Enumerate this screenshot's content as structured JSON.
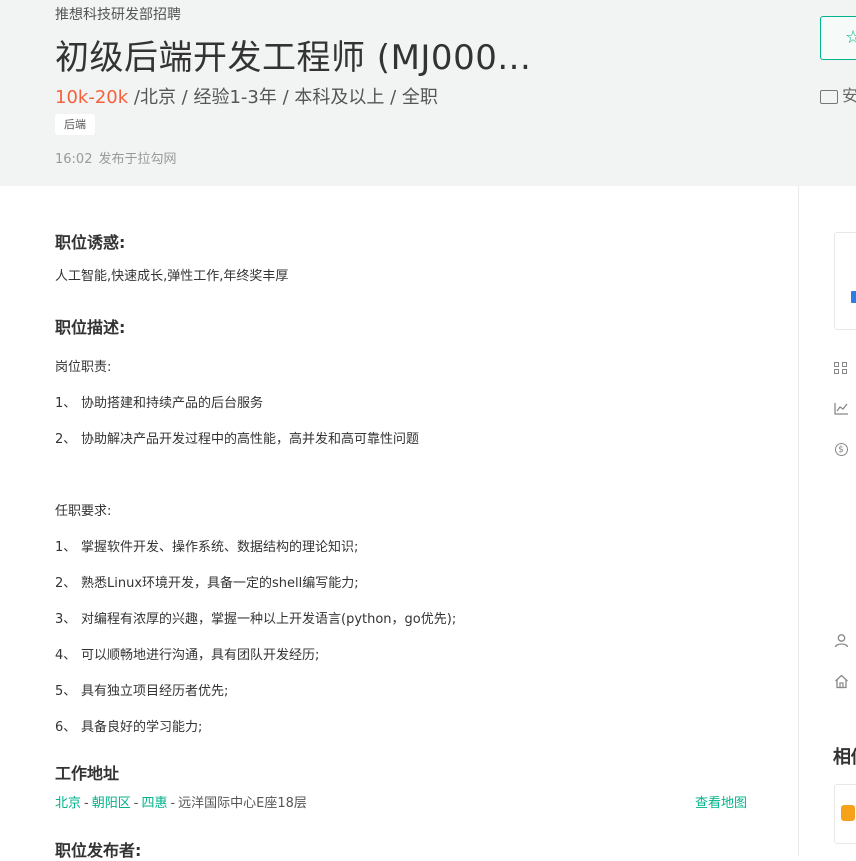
{
  "header": {
    "department": "推想科技研发部招聘",
    "title": "初级后端开发工程师 (MJ000...",
    "salary": "10k-20k",
    "details": " /北京 / 经验1-3年 / 本科及以上 / 全职",
    "tag": "后端",
    "publish_time": "16:02",
    "publish_source": "发布于拉勾网",
    "report_label": "安"
  },
  "content": {
    "perks_title": "职位诱惑:",
    "perks_text": "人工智能,快速成长,弹性工作,年终奖丰厚",
    "desc_title": "职位描述:",
    "duties_heading": "岗位职责:",
    "duties": [
      {
        "num": "1、",
        "text": "协助搭建和持续产品的后台服务"
      },
      {
        "num": "2、",
        "text": "协助解决产品开发过程中的高性能，高并发和高可靠性问题"
      }
    ],
    "req_heading": "任职要求:",
    "requirements": [
      {
        "num": "1、",
        "text": "掌握软件开发、操作系统、数据结构的理论知识;"
      },
      {
        "num": "2、",
        "text": "熟悉Linux环境开发，具备一定的shell编写能力;"
      },
      {
        "num": "3、",
        "text": "对编程有浓厚的兴趣，掌握一种以上开发语言(python，go优先);"
      },
      {
        "num": "4、",
        "text": "可以顺畅地进行沟通，具有团队开发经历;"
      },
      {
        "num": "5、",
        "text": "具有独立项目经历者优先;"
      },
      {
        "num": "6、",
        "text": "具备良好的学习能力;"
      }
    ],
    "address_title": "工作地址",
    "address": {
      "city": "北京",
      "district": "朝阳区",
      "area": "四惠",
      "detail": "远洋国际中心E座18层",
      "dash": "-"
    },
    "map_link": "查看地图",
    "publisher_title": "职位发布者:"
  },
  "sidebar": {
    "heading": "相似"
  },
  "colors": {
    "accent": "#00b38a",
    "salary": "#f5613d",
    "header_bg": "#f2f4f3"
  }
}
